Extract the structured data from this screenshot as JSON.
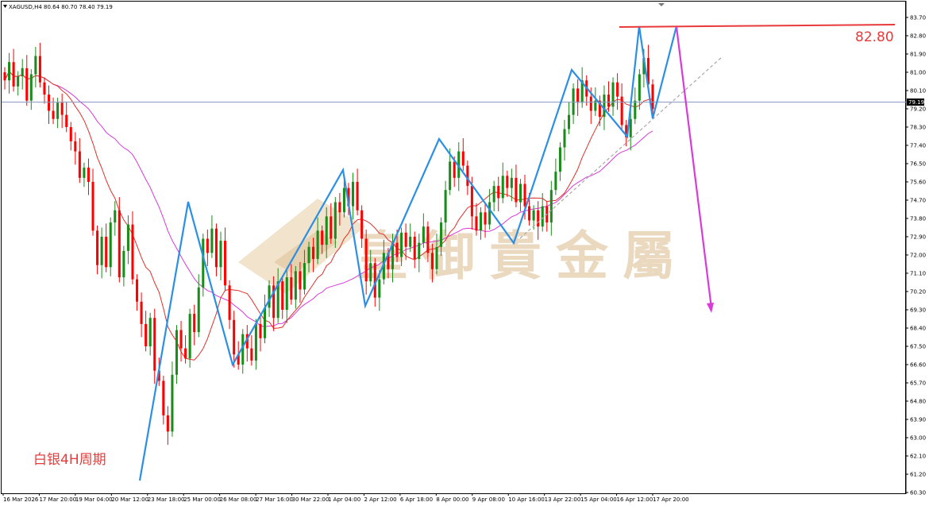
{
  "header": {
    "symbol_line": "XAGUSD,H4  80.64 80.70 78.40 79.19"
  },
  "watermark": {
    "text": "皇御貴金屬"
  },
  "caption": {
    "text": "白银4H周期"
  },
  "level": {
    "text": "82.80",
    "price": 82.8
  },
  "current_price": {
    "text": "79.19",
    "price": 79.19
  },
  "colors": {
    "bull": "#1a8c1a",
    "bear": "#ff0000",
    "zigzag": "#2b8fe6",
    "ma_fast": "#e0302a",
    "ma_slow": "#d93bd9",
    "level": "#e83a3a",
    "projection": "#d93bd9",
    "trendline": "#a8a8a8",
    "current_line": "#8a9cc4",
    "price_tag_bg": "#000000"
  },
  "chart_data": {
    "type": "candlestick",
    "symbol": "XAGUSD",
    "timeframe": "H4",
    "ylim": [
      60.3,
      84.05
    ],
    "grid": false,
    "y_ticks": [
      "83.70",
      "82.80",
      "81.90",
      "81.00",
      "80.10",
      "79.20",
      "78.30",
      "77.40",
      "76.50",
      "75.60",
      "74.70",
      "73.80",
      "72.90",
      "72.00",
      "71.10",
      "70.20",
      "69.30",
      "68.40",
      "67.50",
      "66.60",
      "65.70",
      "64.80",
      "63.90",
      "63.00",
      "62.10",
      "61.20",
      "60.30"
    ],
    "x_ticks": [
      "16 Mar 2026",
      "17 Mar 20:00",
      "19 Mar 04:00",
      "20 Mar 12:00",
      "23 Mar 18:00",
      "25 Mar 00:00",
      "26 Mar 08:00",
      "27 Mar 16:00",
      "30 Mar 22:00",
      "1 Apr 04:00",
      "2 Apr 12:00",
      "6 Apr 18:00",
      "8 Apr 00:00",
      "9 Apr 08:00",
      "10 Apr 16:00",
      "13 Apr 22:00",
      "15 Apr 04:00",
      "16 Apr 12:00",
      "17 Apr 20:00"
    ],
    "closes": [
      80.6,
      81.5,
      80.3,
      80.8,
      81.2,
      79.6,
      80.9,
      81.8,
      80.5,
      79.9,
      79.1,
      78.7,
      79.5,
      78.9,
      78.3,
      77.6,
      77.1,
      75.8,
      76.3,
      75.6,
      73.2,
      71.5,
      72.9,
      71.4,
      73.6,
      74.2,
      70.9,
      72.2,
      73.5,
      70.8,
      69.7,
      68.6,
      67.5,
      68.9,
      66.3,
      65.8,
      64.1,
      63.3,
      66.1,
      68.3,
      67.4,
      66.9,
      69.1,
      68.2,
      70.4,
      72.8,
      72.1,
      73.3,
      71.4,
      72.7,
      70.5,
      68.8,
      67.1,
      66.6,
      68.1,
      67.4,
      66.8,
      68.6,
      67.9,
      69.4,
      70.5,
      68.9,
      70.7,
      69.3,
      70.9,
      69.8,
      71.2,
      70.3,
      71.6,
      72.4,
      71.8,
      73.2,
      72.5,
      73.9,
      72.8,
      74.6,
      74.1,
      75.3,
      74.4,
      75.6,
      74.2,
      72.8,
      70.7,
      71.6,
      69.9,
      70.8,
      72.1,
      71.3,
      72.6,
      71.9,
      73.1,
      72.4,
      72.9,
      71.8,
      72.6,
      73.4,
      72.1,
      71.3,
      72.4,
      73.6,
      75.2,
      76.6,
      75.8,
      77.1,
      76.4,
      75.4,
      73.9,
      73.2,
      74.1,
      73.5,
      74.6,
      75.4,
      74.8,
      75.9,
      75.3,
      75.8,
      74.6,
      75.5,
      74.4,
      73.7,
      74.2,
      73.4,
      74.4,
      73.6,
      75.2,
      76.1,
      77.3,
      78.2,
      78.9,
      80.2,
      79.5,
      80.6,
      79.8,
      79.1,
      79.6,
      78.8,
      79.9,
      79.3,
      80.5,
      79.8,
      78.4,
      77.8,
      78.7,
      79.6,
      80.9,
      81.7,
      80.4,
      79.19
    ]
  }
}
